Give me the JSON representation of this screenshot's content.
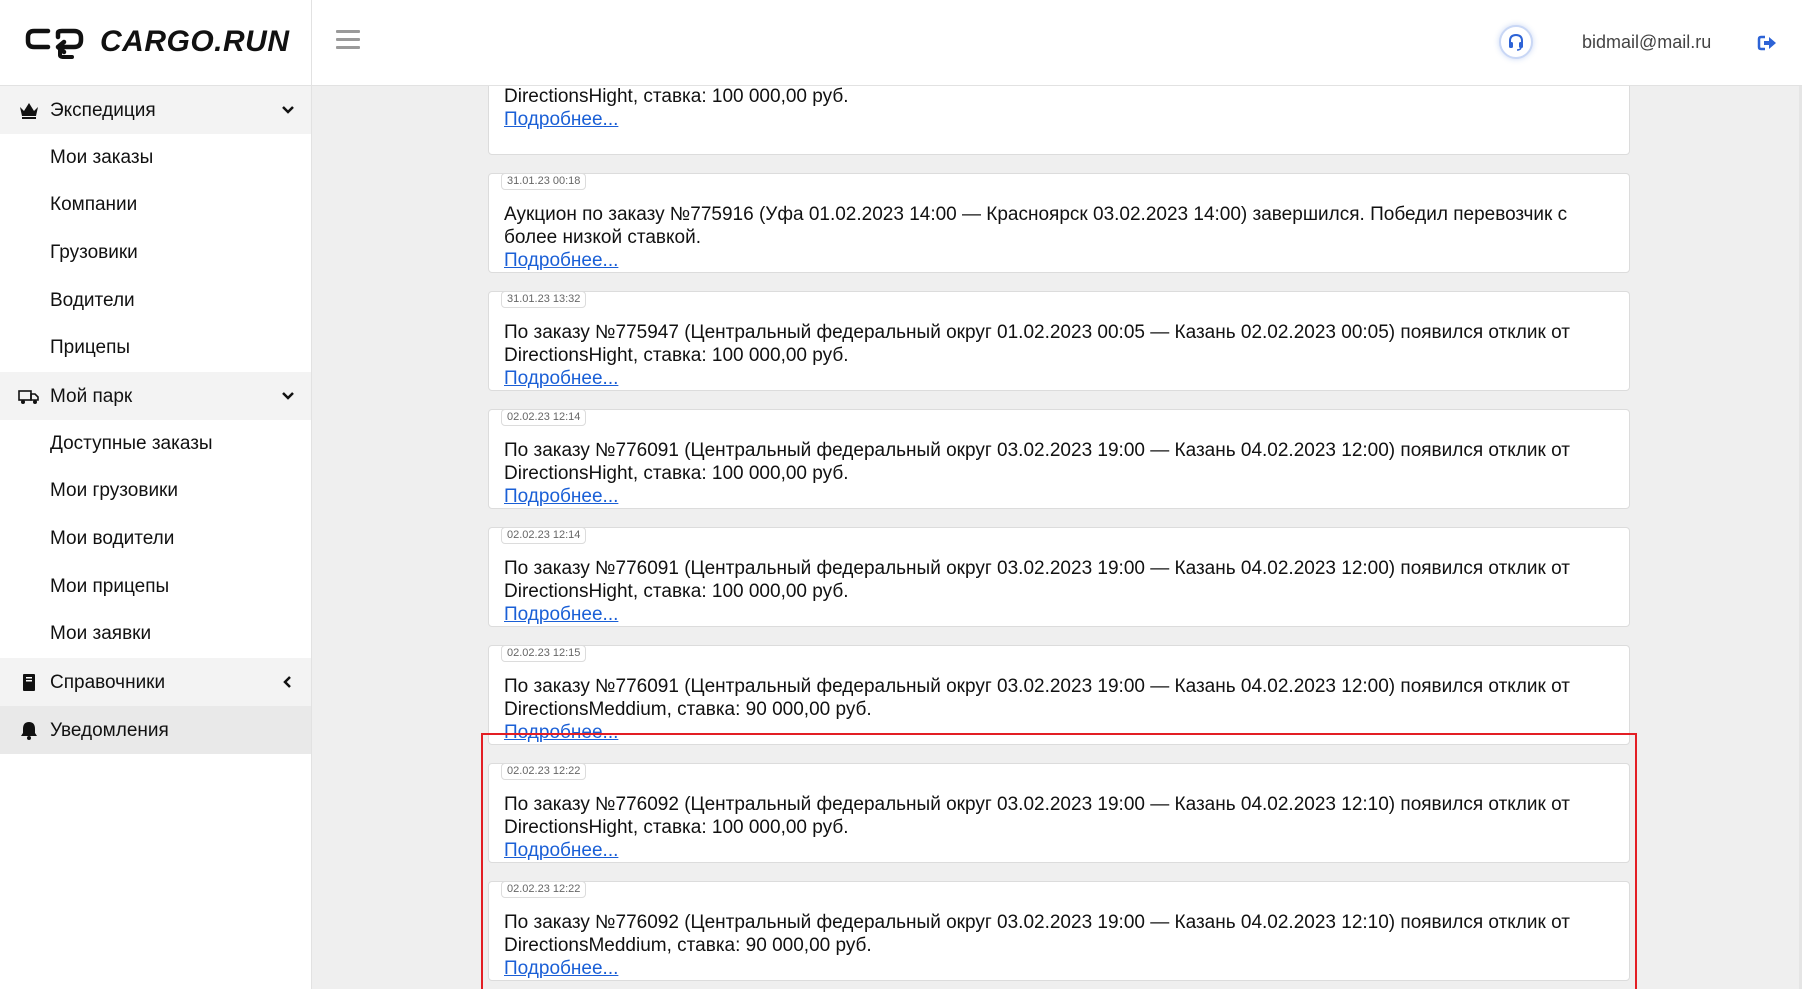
{
  "header": {
    "logo_text": "CARGO.RUN",
    "user_email": "bidmail@mail.ru"
  },
  "sidebar": {
    "sections": [
      {
        "label": "Экспедиция",
        "icon": "crown-icon",
        "expanded": true,
        "items": [
          "Мои заказы",
          "Компании",
          "Грузовики",
          "Водители",
          "Прицепы"
        ]
      },
      {
        "label": "Мой парк",
        "icon": "truck-icon",
        "expanded": true,
        "items": [
          "Доступные заказы",
          "Мои грузовики",
          "Мои водители",
          "Мои прицепы",
          "Мои заявки"
        ]
      },
      {
        "label": "Справочники",
        "icon": "book-icon",
        "expanded": false,
        "items": []
      },
      {
        "label": "Уведомления",
        "icon": "bell-icon",
        "active": true,
        "items": []
      }
    ]
  },
  "notifications": [
    {
      "time": "",
      "message": "DirectionsHight, ставка: 100 000,00 руб.",
      "link": "Подробнее..."
    },
    {
      "time": "31.01.23 00:18",
      "message": "Аукцион по заказу №775916 (Уфа 01.02.2023 14:00 — Красноярск 03.02.2023 14:00) завершился. Победил перевозчик с более низкой ставкой.",
      "link": "Подробнее..."
    },
    {
      "time": "31.01.23 13:32",
      "message": "По заказу №775947 (Центральный федеральный округ 01.02.2023 00:05 — Казань 02.02.2023 00:05) появился отклик от DirectionsHight, ставка: 100 000,00 руб.",
      "link": "Подробнее..."
    },
    {
      "time": "02.02.23 12:14",
      "message": "По заказу №776091 (Центральный федеральный округ 03.02.2023 19:00 — Казань 04.02.2023 12:00) появился отклик от DirectionsHight, ставка: 100 000,00 руб.",
      "link": "Подробнее..."
    },
    {
      "time": "02.02.23 12:14",
      "message": "По заказу №776091 (Центральный федеральный округ 03.02.2023 19:00 — Казань 04.02.2023 12:00) появился отклик от DirectionsHight, ставка: 100 000,00 руб.",
      "link": "Подробнее..."
    },
    {
      "time": "02.02.23 12:15",
      "message": "По заказу №776091 (Центральный федеральный округ 03.02.2023 19:00 — Казань 04.02.2023 12:00) появился отклик от DirectionsMeddium, ставка: 90 000,00 руб.",
      "link": "Подробнее..."
    },
    {
      "time": "02.02.23 12:22",
      "message": "По заказу №776092 (Центральный федеральный округ 03.02.2023 19:00 — Казань 04.02.2023 12:10) появился отклик от DirectionsHight, ставка: 100 000,00 руб.",
      "link": "Подробнее..."
    },
    {
      "time": "02.02.23 12:22",
      "message": "По заказу №776092 (Центральный федеральный округ 03.02.2023 19:00 — Казань 04.02.2023 12:10) появился отклик от DirectionsMeddium, ставка: 90 000,00 руб.",
      "link": "Подробнее..."
    }
  ],
  "colors": {
    "link": "#1a5fd6",
    "highlight_border": "#e31e24",
    "background": "#efefef"
  }
}
